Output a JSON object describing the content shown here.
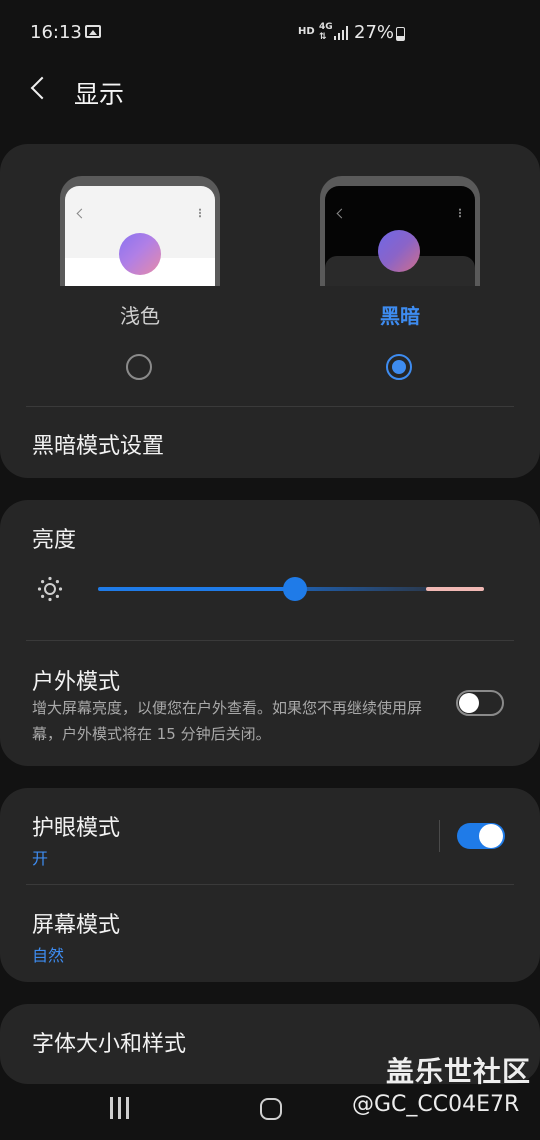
{
  "status_bar": {
    "time": "16:13",
    "hd": "HD",
    "network": "4G",
    "battery": "27%"
  },
  "header": {
    "title": "显示"
  },
  "theme": {
    "light_label": "浅色",
    "dark_label": "黑暗",
    "selected": "dark",
    "dark_mode_settings": "黑暗模式设置"
  },
  "brightness": {
    "label": "亮度",
    "level_fraction": 0.51
  },
  "outdoor_mode": {
    "title": "户外模式",
    "description": "增大屏幕亮度，以便您在户外查看。如果您不再继续使用屏幕，户外模式将在 15 分钟后关闭。",
    "enabled": false
  },
  "eye_comfort": {
    "title": "护眼模式",
    "status": "开",
    "enabled": true
  },
  "screen_mode": {
    "title": "屏幕模式",
    "value": "自然"
  },
  "font": {
    "title": "字体大小和样式"
  },
  "watermark": {
    "line1": "盖乐世社区",
    "line2": "@GC_CC04E7R"
  },
  "colors": {
    "accent": "#3e8cf0",
    "background": "#121212",
    "card": "#262626"
  }
}
